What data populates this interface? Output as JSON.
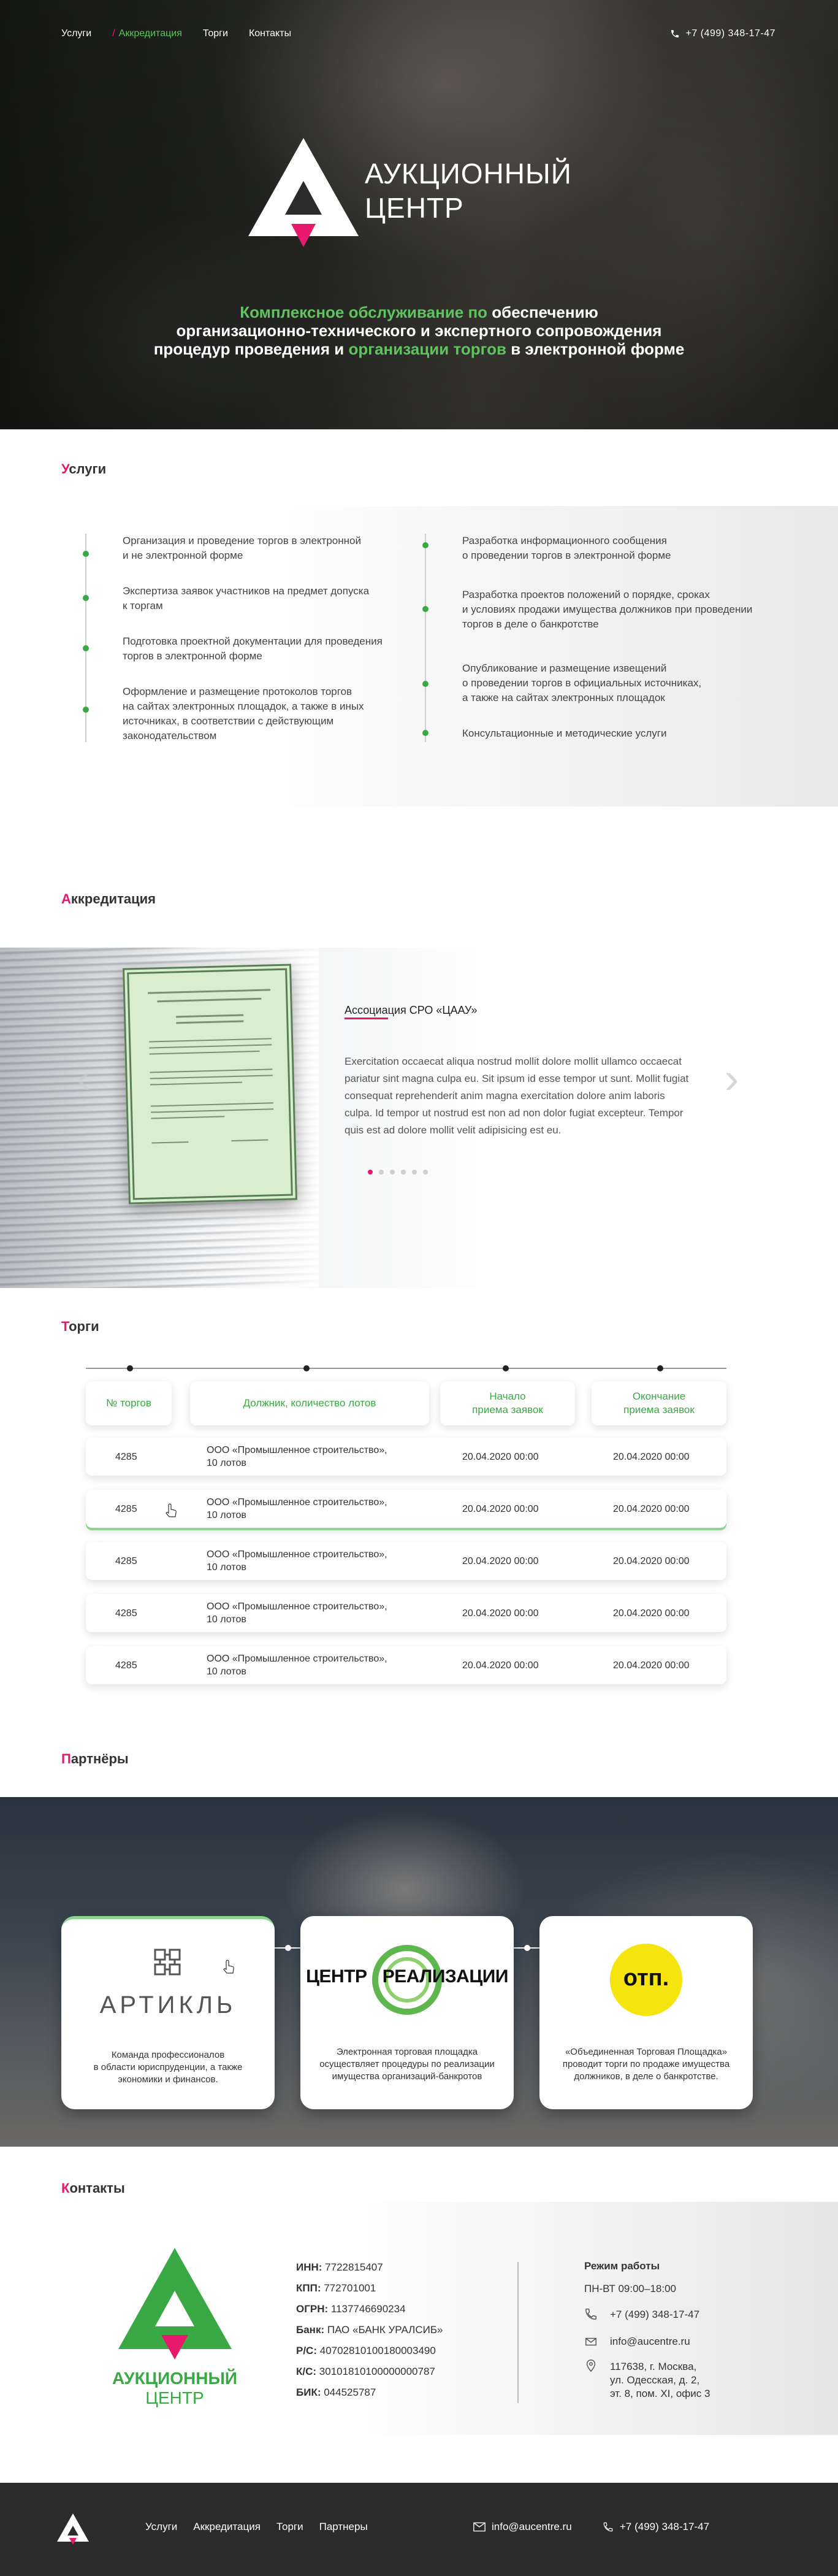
{
  "nav": {
    "items": [
      "Услуги",
      "Аккредитация",
      "Торги",
      "Контакты"
    ],
    "active_slash": "/"
  },
  "header": {
    "phone": "+7 (499) 348-17-47"
  },
  "hero": {
    "logo_line1": "АУКЦИОННЫЙ",
    "logo_line2": "ЦЕНТР",
    "sub1_green": "Комплексное обслуживание по ",
    "sub1_white": "обеспечению",
    "sub2": "организационно-технического и экспертного сопровождения",
    "sub3_white_a": "процедур проведения и ",
    "sub3_green": "организации торгов",
    "sub3_white_b": " в электронной форме"
  },
  "services": {
    "title_first": "У",
    "title_rest": "слуги",
    "left": [
      "Организация и проведение торгов в электронной\nи не электронной форме",
      "Экспертиза заявок участников на предмет допуска\nк торгам",
      "Подготовка проектной документации для проведения\nторгов в электронной форме",
      "Оформление и размещение протоколов торгов\nна сайтах электронных площадок, а также в иных\nисточниках, в соответствии с действующим\nзаконодательством"
    ],
    "right": [
      "Разработка информационного сообщения\nо проведении торгов в электронной форме",
      "Разработка проектов положений о порядке, сроках\nи условиях продажи имущества должников при проведении\nторгов в деле о банкротстве",
      "Опубликование и размещение извещений\nо проведении торгов в официальных источниках,\nа также на сайтах электронных площадок",
      "Консультационные и методические услуги"
    ]
  },
  "accreditation": {
    "title_first": "А",
    "title_rest": "ккредитация",
    "name_u": "Ассоциа",
    "name_rest": "ция СРО «ЦААУ»",
    "text": "Exercitation occaecat aliqua nostrud mollit dolore mollit ullamco occaecat pariatur sint magna culpa eu. Sit ipsum id esse tempor ut sunt. Mollit fugiat consequat reprehenderit anim magna exercitation dolore anim laboris culpa. Id tempor ut nostrud est non ad non dolor fugiat excepteur. Tempor quis est ad dolore mollit velit adipisicing est eu.",
    "prev_arrow": "‹",
    "next_arrow": "›"
  },
  "torgi": {
    "title_first": "Т",
    "title_rest": "орги",
    "headers": [
      "№ торгов",
      "Должник, количество лотов",
      "Начало\nприема заявок",
      "Окончание\nприема заявок"
    ],
    "rows": [
      {
        "num": "4285",
        "debtor": "ООО «Промышленное строительство»,\n10 лотов",
        "start": "20.04.2020 00:00",
        "end": "20.04.2020 00:00"
      },
      {
        "num": "4285",
        "debtor": "ООО «Промышленное строительство»,\n10 лотов",
        "start": "20.04.2020 00:00",
        "end": "20.04.2020 00:00"
      },
      {
        "num": "4285",
        "debtor": "ООО «Промышленное строительство»,\n10 лотов",
        "start": "20.04.2020 00:00",
        "end": "20.04.2020 00:00"
      },
      {
        "num": "4285",
        "debtor": "ООО «Промышленное строительство»,\n10 лотов",
        "start": "20.04.2020 00:00",
        "end": "20.04.2020 00:00"
      },
      {
        "num": "4285",
        "debtor": "ООО «Промышленное строительство»,\n10 лотов",
        "start": "20.04.2020 00:00",
        "end": "20.04.2020 00:00"
      }
    ]
  },
  "partners": {
    "title_first": "П",
    "title_rest": "артнёры",
    "cards": [
      {
        "logo": "АРТИКЛЬ",
        "text": "Команда профессионалов\nв области юриспруденции, а также\nэкономики и финансов."
      },
      {
        "logo_a": "ЦЕНТР",
        "logo_b": "РЕАЛИЗАЦИИ",
        "text": "Электронная торговая площадка\nосуществляет процедуры по реализации\nимущества организаций-банкротов"
      },
      {
        "logo": "отп.",
        "text": "«Объединенная Торговая Площадка»\nпроводит торги по продаже имущества\nдолжников, в деле о банкротстве."
      }
    ]
  },
  "contacts": {
    "title_first": "К",
    "title_rest": "онтакты",
    "logo_line1": "АУКЦИОННЫЙ",
    "logo_line2": "ЦЕНТР",
    "requisites": [
      {
        "label": "ИНН:",
        "value": "7722815407"
      },
      {
        "label": "КПП:",
        "value": "772701001"
      },
      {
        "label": "ОГРН:",
        "value": "1137746690234"
      },
      {
        "label": "Банк:",
        "value": "ПАО «БАНК УРАЛСИБ»"
      },
      {
        "label": "Р/С:",
        "value": "40702810100180003490"
      },
      {
        "label": "К/С:",
        "value": "30101810100000000787"
      },
      {
        "label": "БИК:",
        "value": "044525787"
      }
    ],
    "hours_title": "Режим работы",
    "hours": "ПН-ВТ 09:00–18:00",
    "phone": "+7 (499) 348-17-47",
    "email": "info@aucentre.ru",
    "address": "117638, г. Москва,\nул. Одесская, д. 2,\nэт. 8, пом. XI, офис 3"
  },
  "footer": {
    "nav": [
      "Услуги",
      "Аккредитация",
      "Торги",
      "Партнеры"
    ],
    "email": "info@aucentre.ru",
    "phone": "+7 (499) 348-17-47"
  },
  "colors": {
    "accent_green": "#3aa845",
    "light_green": "#5fc45e",
    "accent_pink": "#e8196c",
    "dark": "#2b2b2b"
  }
}
